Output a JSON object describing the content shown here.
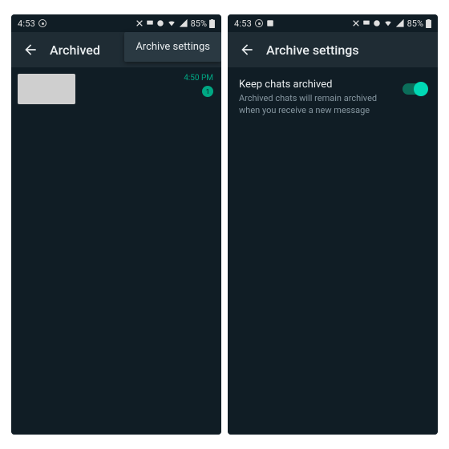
{
  "status": {
    "time": "4:53",
    "battery_pct": "85%"
  },
  "left": {
    "title": "Archived",
    "menu_item": "Archive settings",
    "chat": {
      "time": "4:50 PM",
      "badge": "1"
    }
  },
  "right": {
    "title": "Archive settings",
    "setting": {
      "title": "Keep chats archived",
      "desc": "Archived chats will remain archived when you receive a new message"
    }
  },
  "colors": {
    "accent": "#00a884",
    "bg": "#101d25",
    "bar": "#1f2c34"
  }
}
